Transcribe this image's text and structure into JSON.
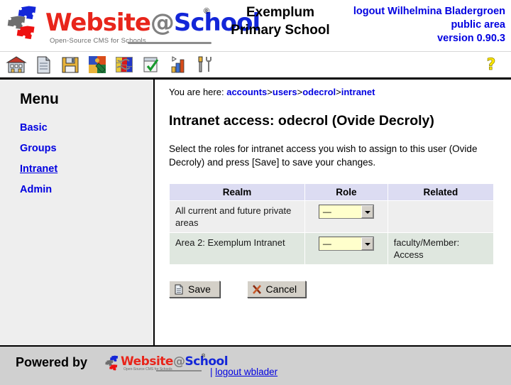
{
  "header": {
    "logo": {
      "text_website": "Website",
      "text_at": "@",
      "text_school": "School",
      "registered": "®",
      "tagline": "Open-Source CMS for Schools"
    },
    "school_name_line1": "Exemplum",
    "school_name_line2": "Primary School",
    "logout_label": "logout Wilhelmina Bladergroen",
    "area_label": "public area",
    "version_label": "version 0.90.3"
  },
  "toolbar": {
    "icons": [
      {
        "name": "home-icon",
        "title": "Home"
      },
      {
        "name": "page-icon",
        "title": "Page"
      },
      {
        "name": "save-disk-icon",
        "title": "Save"
      },
      {
        "name": "modules-icon",
        "title": "Modules"
      },
      {
        "name": "areas-icon",
        "title": "Areas"
      },
      {
        "name": "tasks-icon",
        "title": "Tasks"
      },
      {
        "name": "statistics-icon",
        "title": "Statistics"
      },
      {
        "name": "tools-icon",
        "title": "Tools"
      }
    ],
    "help_icon": "help-question-icon"
  },
  "sidebar": {
    "title": "Menu",
    "items": [
      {
        "label": "Basic",
        "active": false
      },
      {
        "label": "Groups",
        "active": false
      },
      {
        "label": "Intranet",
        "active": true
      },
      {
        "label": "Admin",
        "active": false
      }
    ]
  },
  "breadcrumb": {
    "prefix": "You are here:",
    "items": [
      "accounts",
      "users",
      "odecrol",
      "intranet"
    ],
    "separator": ">"
  },
  "main": {
    "page_title": "Intranet access: odecrol (Ovide Decroly)",
    "intro": "Select the roles for intranet access you wish to assign to this user (Ovide Decroly) and press [Save] to save your changes."
  },
  "table": {
    "headers": [
      "Realm",
      "Role",
      "Related"
    ],
    "rows": [
      {
        "realm": "All current and future private areas",
        "role_value": "—",
        "related": ""
      },
      {
        "realm": "Area 2: Exemplum Intranet",
        "role_value": "—",
        "related": "faculty/Member: Access"
      }
    ]
  },
  "buttons": {
    "save_label": "Save",
    "cancel_label": "Cancel"
  },
  "footer": {
    "powered_by": "Powered by",
    "logo": {
      "text_website": "Website",
      "text_at": "@",
      "text_school": "School",
      "registered": "®",
      "tagline": "Open-Source CMS for Schools"
    },
    "pipe": "|",
    "logout_label": "logout wblader"
  },
  "colors": {
    "link_blue": "#0000e0",
    "logo_red": "#e8251b",
    "logo_blue": "#1326d8",
    "logo_gray": "#808080",
    "table_header_bg": "#dcdcf2",
    "row_a_bg": "#eeeeee",
    "row_b_bg": "#dfe7df",
    "select_bg": "#ffffcc",
    "sidebar_bg": "#eeeeee",
    "footer_bg": "#d0d0d0"
  }
}
